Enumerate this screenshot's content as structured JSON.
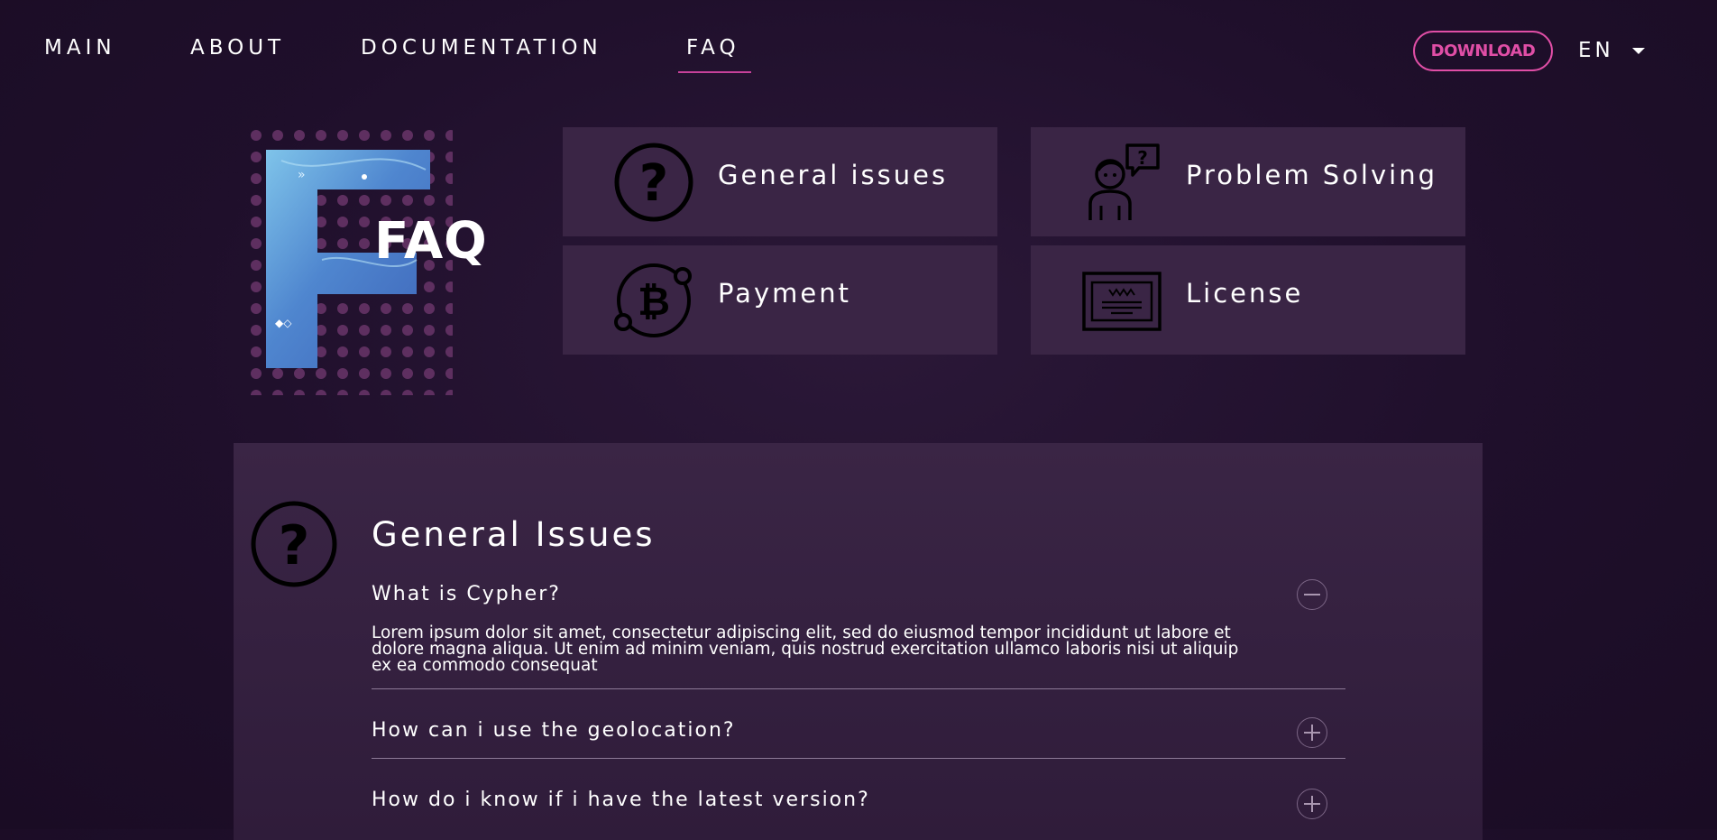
{
  "nav": {
    "links": [
      {
        "label": "MAIN"
      },
      {
        "label": "ABOUT"
      },
      {
        "label": "DOCUMENTATION"
      },
      {
        "label": "FAQ",
        "active": true
      }
    ],
    "download_label": "DOWNLOAD",
    "language": "EN"
  },
  "hero": {
    "title": "FAQ"
  },
  "categories": [
    {
      "label": "General issues",
      "icon": "question-circle-icon"
    },
    {
      "label": "Problem Solving",
      "icon": "person-question-icon"
    },
    {
      "label": "Payment",
      "icon": "bitcoin-icon"
    },
    {
      "label": "License",
      "icon": "certificate-icon"
    }
  ],
  "section": {
    "title": "General Issues",
    "icon": "question-circle-icon",
    "questions": [
      {
        "question": "What is Cypher?",
        "expanded": true,
        "answer": "Lorem ipsum dolor sit amet, consectetur adipiscing elit, sed do eiusmod tempor incididunt ut labore et dolore magna aliqua. Ut enim ad minim veniam, quis nostrud exercitation ullamco laboris nisi ut aliquip ex ea commodo consequat"
      },
      {
        "question": "How can i use the geolocation?",
        "expanded": false
      },
      {
        "question": "How do i know if i have the latest version?",
        "expanded": false
      }
    ]
  },
  "colors": {
    "background": "#1f0f2b",
    "card": "#3a2545",
    "accent": "#e04ea6"
  }
}
